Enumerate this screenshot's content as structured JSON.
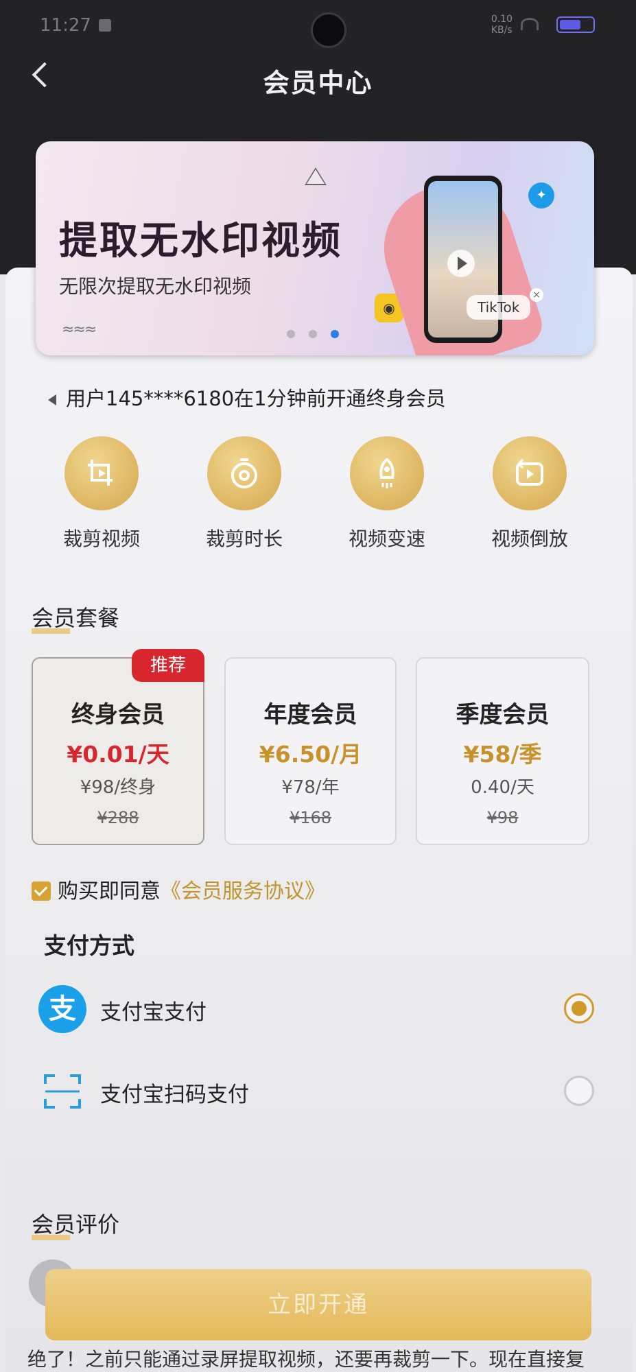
{
  "status_bar": {
    "time": "11:27",
    "net": "0.10\nKB/s"
  },
  "header": {
    "title": "会员中心"
  },
  "banner": {
    "title": "提取无水印视频",
    "subtitle": "无限次提取无水印视频",
    "tiktok_label": "TikTok",
    "active_slide": 3,
    "total_slides": 3
  },
  "notice": {
    "text": "用户145****6180在1分钟前开通终身会员"
  },
  "features": [
    {
      "label": "裁剪视频",
      "icon": "crop-video-icon"
    },
    {
      "label": "裁剪时长",
      "icon": "stopwatch-icon"
    },
    {
      "label": "视频变速",
      "icon": "rocket-icon"
    },
    {
      "label": "视频倒放",
      "icon": "reverse-video-icon"
    }
  ],
  "plans_section": {
    "title": "会员套餐"
  },
  "plans": [
    {
      "name": "终身会员",
      "price": "¥0.01/天",
      "sub": "¥98/终身",
      "original": "¥288",
      "badge": "推荐",
      "selected": true,
      "price_color": "#d8262e"
    },
    {
      "name": "年度会员",
      "price": "¥6.50/月",
      "sub": "¥78/年",
      "original": "¥168",
      "selected": false,
      "price_color": "#c8922a"
    },
    {
      "name": "季度会员",
      "price": "¥58/季",
      "sub": "0.40/天",
      "original": "¥98",
      "selected": false,
      "price_color": "#c8922a"
    }
  ],
  "agreement": {
    "text": "购买即同意",
    "link": "《会员服务协议》",
    "checked": true
  },
  "payment": {
    "title": "支付方式",
    "methods": [
      {
        "label": "支付宝支付",
        "icon": "alipay-icon",
        "selected": true
      },
      {
        "label": "支付宝扫码支付",
        "icon": "scan-icon",
        "selected": false
      }
    ]
  },
  "reviews": {
    "title": "会员评价",
    "first_text": "绝了！之前只能通过录屏提取视频，还要再裁剪一下。现在直接复"
  },
  "cta": {
    "label": "立即开通"
  },
  "colors": {
    "accent_gold": "#d8a232",
    "recommend_red": "#d8262e",
    "alipay_blue": "#1aa0e8"
  }
}
